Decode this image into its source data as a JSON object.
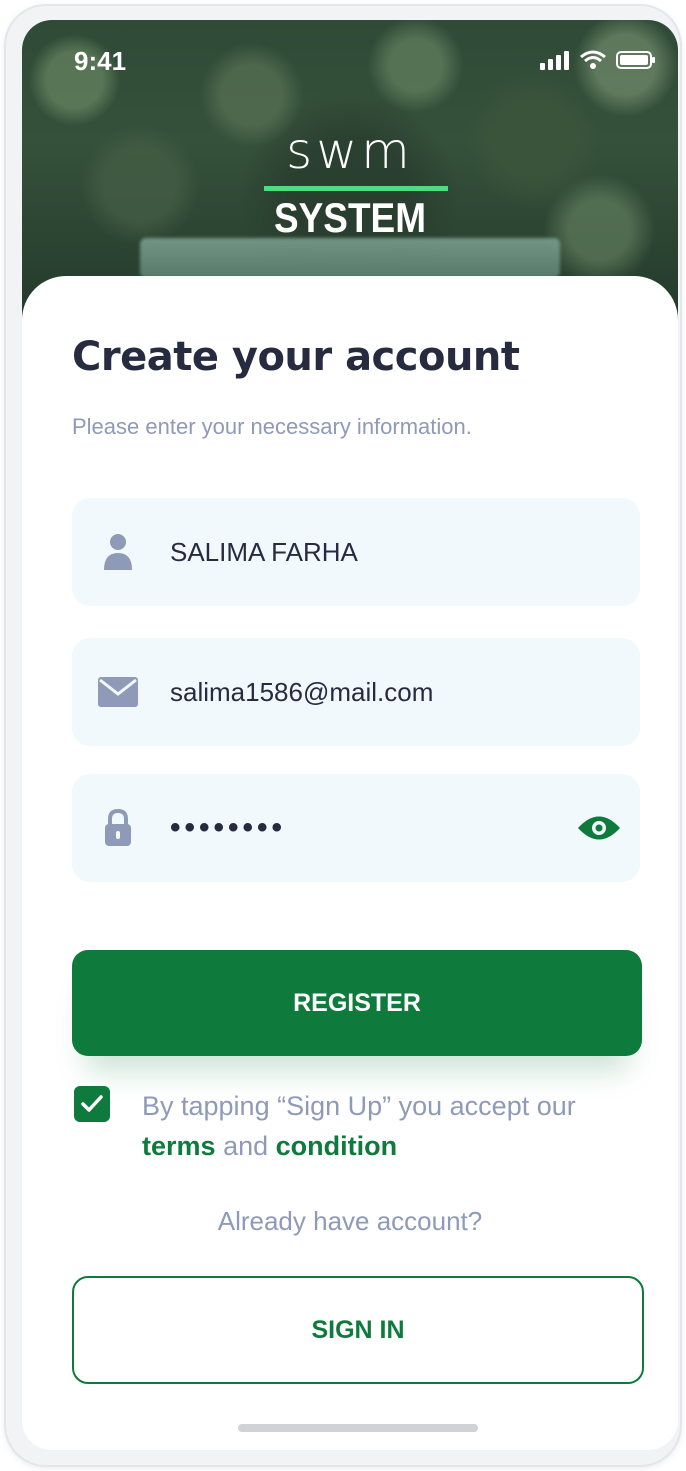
{
  "status_bar": {
    "time": "9:41"
  },
  "logo": {
    "top": "swm",
    "bottom": "SYSTEM",
    "accent_color": "#4ddc7e"
  },
  "header": {
    "title": "Create your account",
    "subtitle": "Please enter your necessary information."
  },
  "form": {
    "name": {
      "value": "SALIMA FARHA",
      "icon": "user-icon"
    },
    "email": {
      "value": "salima1586@mail.com",
      "icon": "mail-icon"
    },
    "password": {
      "value": "••••••••",
      "icon": "lock-icon",
      "toggle_icon": "eye-icon"
    }
  },
  "register_button": {
    "label": "REGISTER"
  },
  "agreement": {
    "checked": true,
    "text": "By tapping “Sign Up” you accept our",
    "link_terms": "terms",
    "and": "and",
    "link_condition": "condition"
  },
  "already": {
    "text": "Already have account?"
  },
  "signin_button": {
    "label": "SIGN IN"
  },
  "colors": {
    "primary": "#0e7a3b",
    "title": "#262b40",
    "muted": "#8e9ab8",
    "field_bg": "#f1f9fd"
  }
}
